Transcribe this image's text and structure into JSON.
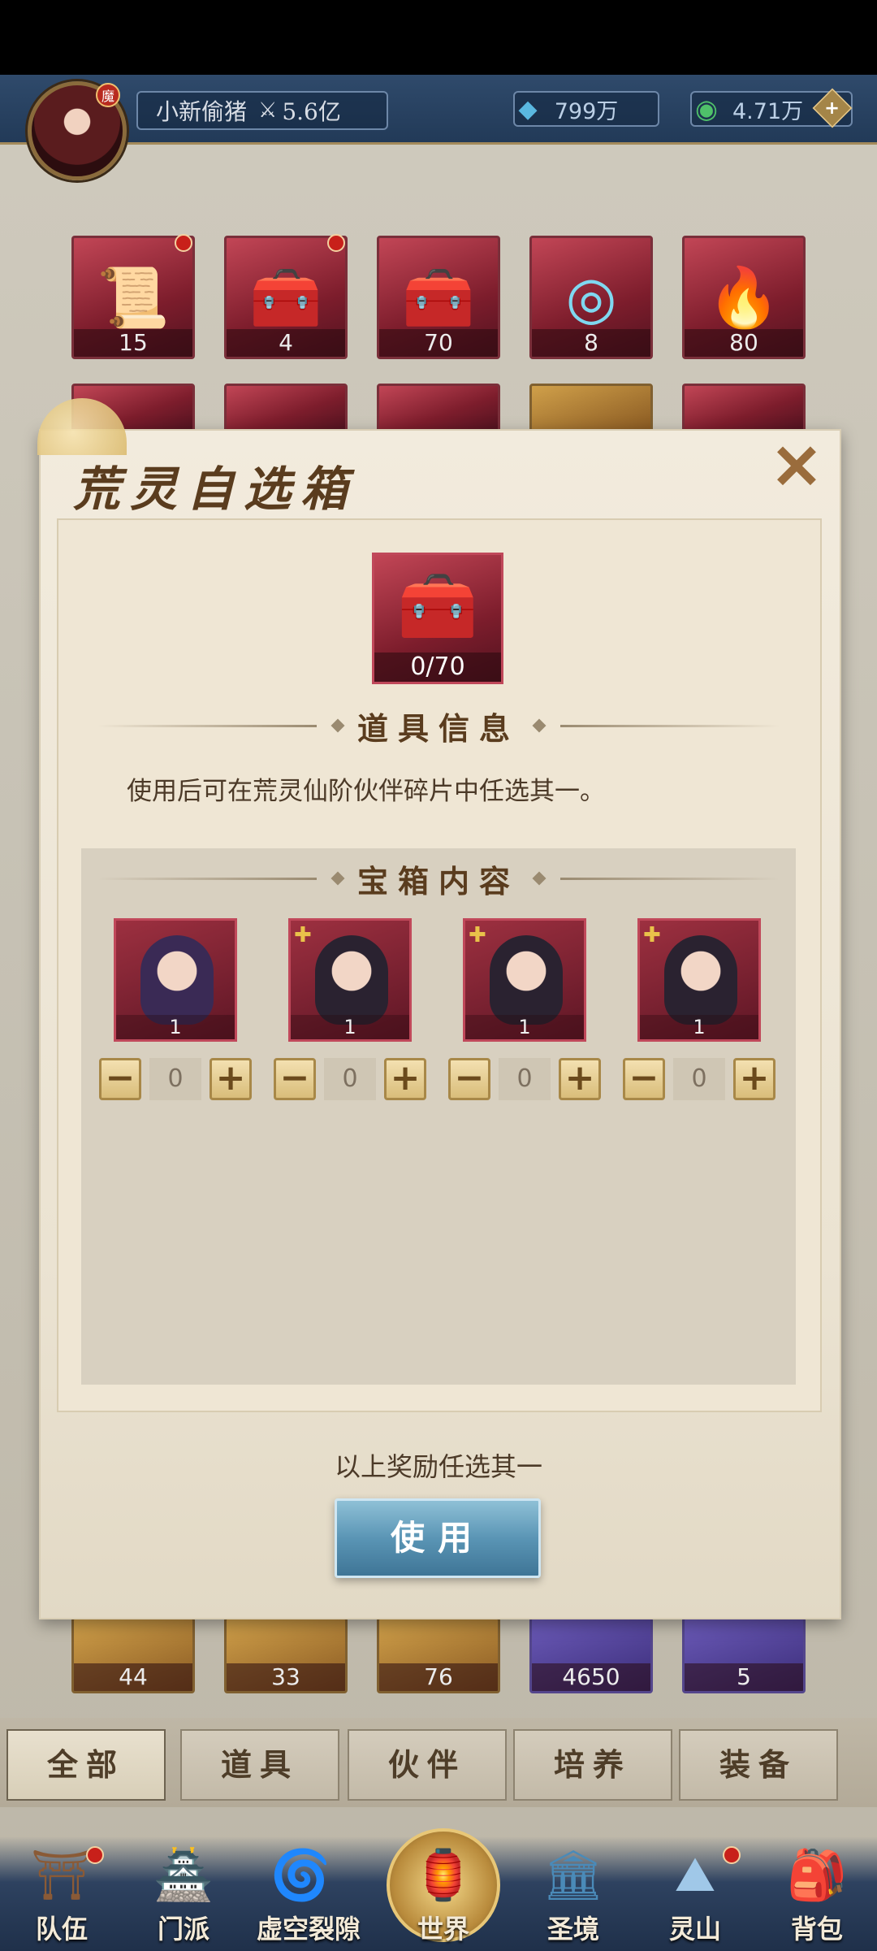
{
  "topbar": {
    "player_name": "小新偷猪",
    "power": "5.6亿",
    "resource1": "799万",
    "resource2": "4.71万",
    "avatar_badge": "魔"
  },
  "inventory_row1": [
    {
      "count": "15",
      "icon": "scroll-icon",
      "dot": true
    },
    {
      "count": "4",
      "icon": "treasure-chest-icon",
      "dot": true
    },
    {
      "count": "70",
      "icon": "treasure-chest-icon",
      "dot": false
    },
    {
      "count": "8",
      "icon": "orb-icon",
      "dot": false
    },
    {
      "count": "80",
      "icon": "flame-icon",
      "dot": false
    }
  ],
  "inventory_bottom_row": [
    {
      "count": "44"
    },
    {
      "count": "33"
    },
    {
      "count": "76"
    },
    {
      "count": "4650"
    },
    {
      "count": "5"
    }
  ],
  "dialog": {
    "title": "荒灵自选箱",
    "item_count": "0/70",
    "info_header": "道具信息",
    "description": "使用后可在荒灵仙阶伙伴碎片中任选其一。",
    "content_header": "宝箱内容",
    "cards": [
      {
        "count": "1",
        "value": "0"
      },
      {
        "count": "1",
        "value": "0"
      },
      {
        "count": "1",
        "value": "0"
      },
      {
        "count": "1",
        "value": "0"
      }
    ],
    "hint": "以上奖励任选其一",
    "use_button": "使用",
    "close_label": "✕"
  },
  "filter_tabs": [
    "全部",
    "道具",
    "伙伴",
    "培养",
    "装备"
  ],
  "nav": [
    "队伍",
    "门派",
    "虚空裂隙",
    "世界",
    "圣境",
    "灵山",
    "背包"
  ],
  "colors": {
    "accent_blue": "#5a95b5",
    "card_red": "#c0485a",
    "dialog_bg": "#f2ebdd"
  }
}
